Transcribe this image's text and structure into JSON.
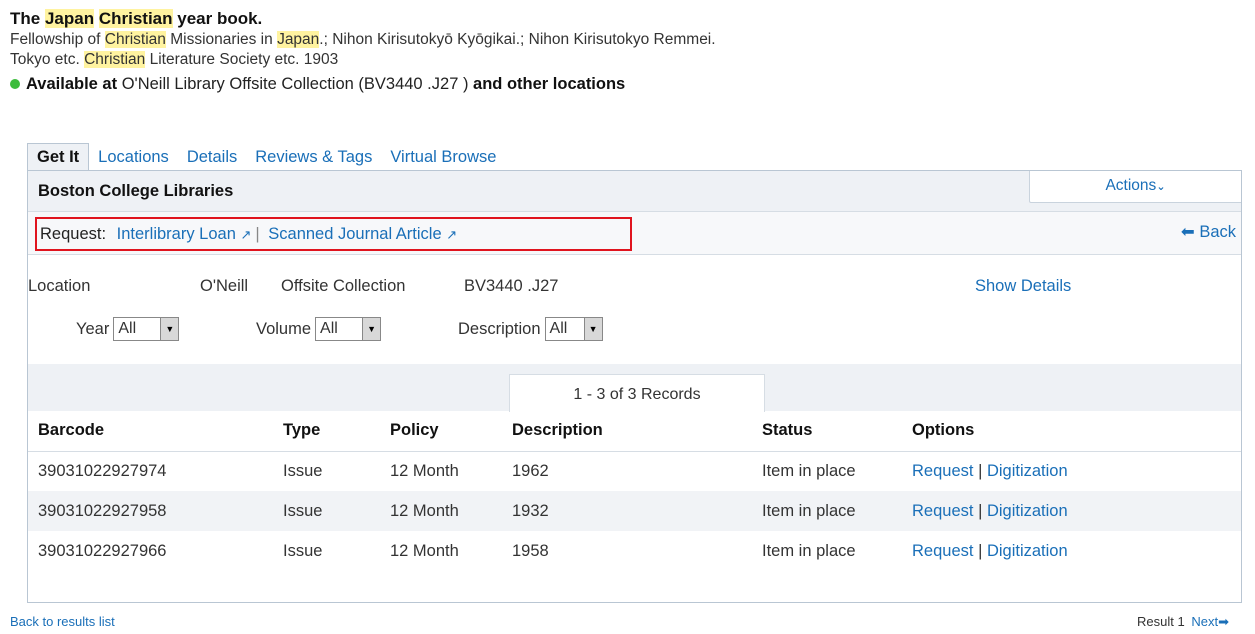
{
  "record": {
    "title_parts": [
      "The ",
      "Japan",
      " ",
      "Christian",
      " year book."
    ],
    "authors_parts": [
      "Fellowship of ",
      "Christian",
      " Missionaries in ",
      "Japan",
      ".; Nihon Kirisutokyō Kyōgikai.; Nihon Kirisutokyo Remmei."
    ],
    "publisher_parts": [
      "Tokyo etc. ",
      "Christian",
      " Literature Society etc. 1903"
    ],
    "availability": {
      "prefix": "Available at",
      "location": "O'Neill Library Offsite Collection (BV3440 .J27 )",
      "suffix": "and other locations"
    }
  },
  "tabs": [
    "Get It",
    "Locations",
    "Details",
    "Reviews & Tags",
    "Virtual Browse"
  ],
  "panel": {
    "library": "Boston College Libraries",
    "actions_label": "Actions",
    "request_label": "Request:",
    "request_links": [
      "Interlibrary Loan",
      "Scanned Journal Article"
    ],
    "separator": "|",
    "back_label": "Back",
    "location": {
      "label": "Location",
      "library": "O'Neill",
      "collection": "Offsite Collection",
      "call_number": "BV3440 .J27",
      "show_details": "Show Details"
    },
    "filters": {
      "year_label": "Year",
      "year_value": "All",
      "volume_label": "Volume",
      "volume_value": "All",
      "description_label": "Description",
      "description_value": "All"
    },
    "records_count": "1 - 3 of 3 Records",
    "columns": [
      "Barcode",
      "Type",
      "Policy",
      "Description",
      "Status",
      "Options"
    ],
    "rows": [
      {
        "barcode": "39031022927974",
        "type": "Issue",
        "policy": "12 Month",
        "description": "1962",
        "status": "Item in place",
        "request": "Request",
        "digitization": "Digitization"
      },
      {
        "barcode": "39031022927958",
        "type": "Issue",
        "policy": "12 Month",
        "description": "1932",
        "status": "Item in place",
        "request": "Request",
        "digitization": "Digitization"
      },
      {
        "barcode": "39031022927966",
        "type": "Issue",
        "policy": "12 Month",
        "description": "1958",
        "status": "Item in place",
        "request": "Request",
        "digitization": "Digitization"
      }
    ]
  },
  "footer": {
    "back_to_results": "Back to results list",
    "result_label": "Result",
    "result_number": "1",
    "next_label": "Next"
  },
  "colors": {
    "highlight": "#fff3a0",
    "link": "#1a6fb8",
    "available_dot": "#3cbc3c",
    "request_box_border": "#e0141e"
  },
  "icons": [
    "available-dot-icon",
    "external-link-icon",
    "chevron-down-icon",
    "back-arrow-icon",
    "dropdown-arrow-icon",
    "next-arrow-icon"
  ]
}
